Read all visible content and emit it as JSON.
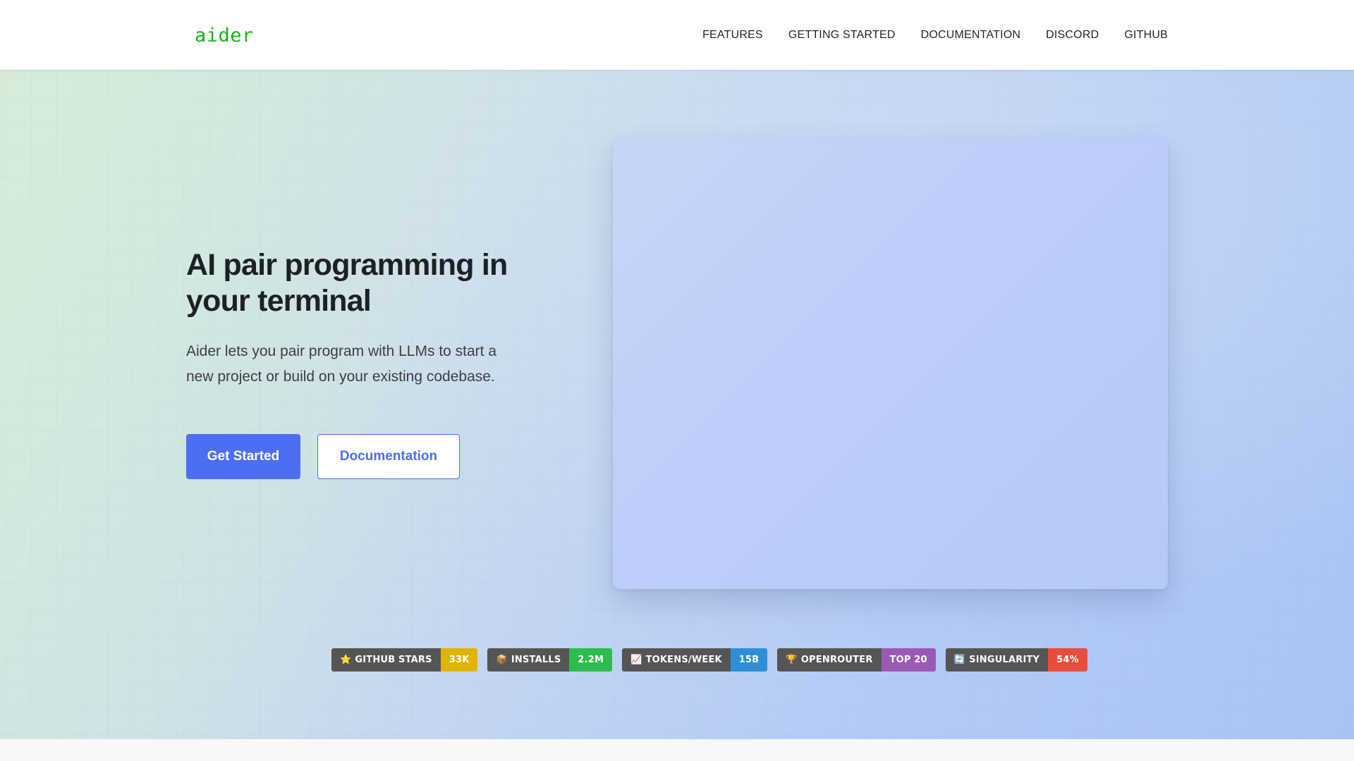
{
  "header": {
    "logo": "aider",
    "nav": [
      "FEATURES",
      "GETTING STARTED",
      "DOCUMENTATION",
      "DISCORD",
      "GITHUB"
    ]
  },
  "hero": {
    "headline": "AI pair programming in your terminal",
    "lede": "Aider lets you pair program with LLMs to start a new project or build on your existing codebase.",
    "primary_button": "Get Started",
    "secondary_button": "Documentation"
  },
  "badges": [
    {
      "icon": "⭐",
      "label": "GITHUB STARS",
      "value": "33K",
      "color": "#e1b400"
    },
    {
      "icon": "📦",
      "label": "INSTALLS",
      "value": "2.2M",
      "color": "#2dbc4e"
    },
    {
      "icon": "📈",
      "label": "TOKENS/WEEK",
      "value": "15B",
      "color": "#2f8fd6"
    },
    {
      "icon": "🏆",
      "label": "OPENROUTER",
      "value": "TOP 20",
      "color": "#9b59b6"
    },
    {
      "icon": "🔄",
      "label": "SINGULARITY",
      "value": "54%",
      "color": "#e74c3c"
    }
  ],
  "colors": {
    "accent": "#4c6ef5",
    "logo": "#14b014",
    "headline": "#1d2125"
  }
}
